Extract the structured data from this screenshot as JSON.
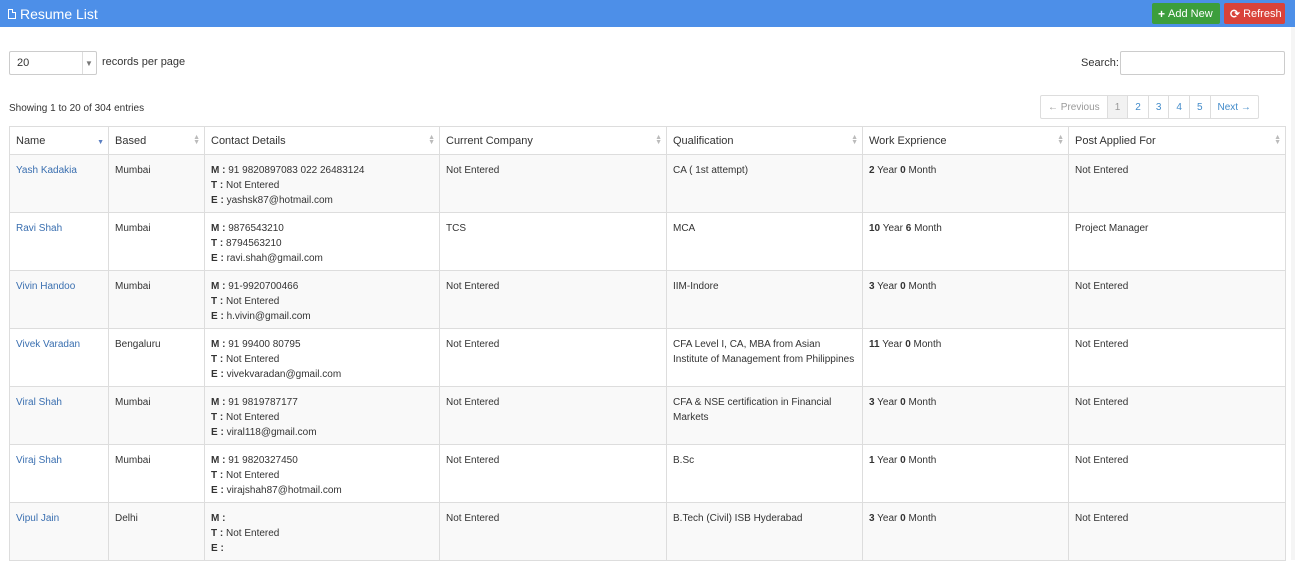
{
  "header": {
    "title": "Resume List",
    "add_label": "Add New",
    "add_icon": "+",
    "refresh_label": "Refresh",
    "refresh_icon": "⟳"
  },
  "controls": {
    "per_page_value": "20",
    "per_page_label": "records per page",
    "search_label": "Search:",
    "search_value": "",
    "showing": "Showing 1 to 20 of 304 entries"
  },
  "pager": {
    "previous": "← Previous",
    "pages": [
      "1",
      "2",
      "3",
      "4",
      "5"
    ],
    "next": "Next →",
    "active_page": "1"
  },
  "columns": [
    "Name",
    "Based",
    "Contact Details",
    "Current Company",
    "Qualification",
    "Work Exprience",
    "Post Applied For"
  ],
  "rows": [
    {
      "name": "Yash Kadakia",
      "based": "Mumbai",
      "m": "91 9820897083 022 26483124",
      "t": "Not Entered",
      "e": "yashsk87@hotmail.com",
      "company": "Not Entered",
      "qualification": "CA ( 1st attempt)",
      "years": "2",
      "months": "0",
      "post": "Not Entered"
    },
    {
      "name": "Ravi Shah",
      "based": "Mumbai",
      "m": "9876543210",
      "t": "8794563210",
      "e": "ravi.shah@gmail.com",
      "company": "TCS",
      "qualification": "MCA",
      "years": "10",
      "months": "6",
      "post": "Project Manager"
    },
    {
      "name": "Vivin Handoo",
      "based": "Mumbai",
      "m": "91-9920700466",
      "t": "Not Entered",
      "e": "h.vivin@gmail.com",
      "company": "Not Entered",
      "qualification": "IIM-Indore",
      "years": "3",
      "months": "0",
      "post": "Not Entered"
    },
    {
      "name": "Vivek Varadan",
      "based": "Bengaluru",
      "m": "91 99400 80795",
      "t": "Not Entered",
      "e": "vivekvaradan@gmail.com",
      "company": "Not Entered",
      "qualification": "CFA Level I, CA, MBA from Asian Institute of Management from Philippines",
      "years": "11",
      "months": "0",
      "post": "Not Entered"
    },
    {
      "name": "Viral Shah",
      "based": "Mumbai",
      "m": "91 9819787177",
      "t": "Not Entered",
      "e": "viral118@gmail.com",
      "company": "Not Entered",
      "qualification": "CFA & NSE certification in Financial Markets",
      "years": "3",
      "months": "0",
      "post": "Not Entered"
    },
    {
      "name": "Viraj Shah",
      "based": "Mumbai",
      "m": "91 9820327450",
      "t": "Not Entered",
      "e": "virajshah87@hotmail.com",
      "company": "Not Entered",
      "qualification": "B.Sc",
      "years": "1",
      "months": "0",
      "post": "Not Entered"
    },
    {
      "name": "Vipul Jain",
      "based": "Delhi",
      "m": "",
      "t": "Not Entered",
      "e": "",
      "company": "Not Entered",
      "qualification": "B.Tech (Civil) ISB Hyderabad",
      "years": "3",
      "months": "0",
      "post": "Not Entered"
    }
  ],
  "labels": {
    "m": "M :",
    "t": "T :",
    "e": "E :",
    "year": "Year",
    "month": "Month"
  }
}
